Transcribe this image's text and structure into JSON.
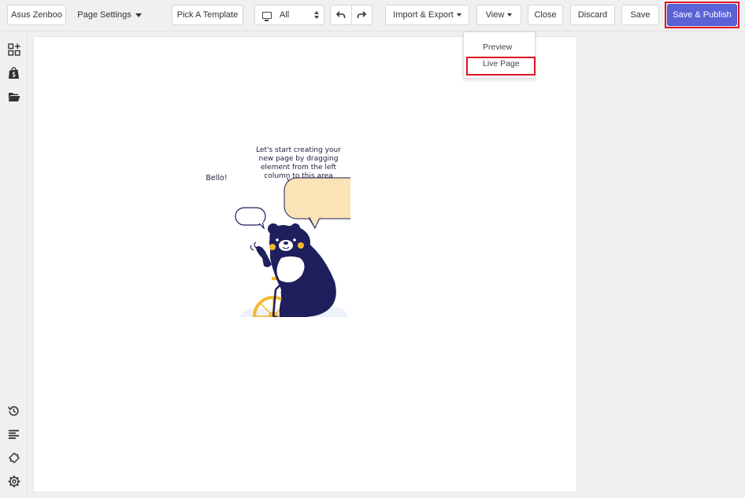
{
  "toolbar": {
    "page_name": "Asus Zenboo",
    "page_settings_label": "Page Settings",
    "pick_template_label": "Pick A Template",
    "device_select_value": "All",
    "import_export_label": "Import & Export",
    "view_label": "View",
    "close_label": "Close",
    "discard_label": "Discard",
    "save_label": "Save",
    "save_publish_label": "Save & Publish"
  },
  "view_menu": {
    "items": [
      {
        "label": "Preview"
      },
      {
        "label": "Live Page"
      }
    ]
  },
  "sidebar": {
    "top_icons": [
      "add-elements-icon",
      "shopify-bag-icon",
      "folder-open-icon"
    ],
    "bottom_icons": [
      "history-icon",
      "align-left-icon",
      "puzzle-icon",
      "settings-gear-icon"
    ]
  },
  "canvas": {
    "speech_bubble_text": "Let's start creating your new page by dragging element from the left column to this area",
    "bello_text": "Bello!"
  },
  "colors": {
    "publish_button": "#5a62d6",
    "highlight_outline": "#e0141e",
    "bear_body": "#1e1f5c",
    "bike_yellow": "#f5b82e",
    "speech_bubble_fill": "#fbe3b5"
  }
}
